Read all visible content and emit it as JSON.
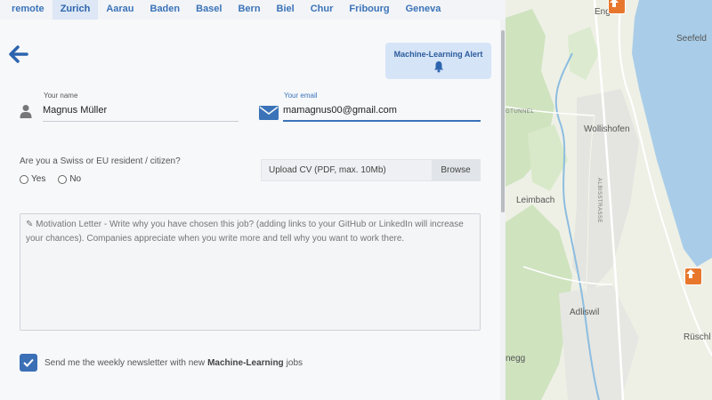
{
  "tabs": [
    {
      "label": "remote",
      "active": false
    },
    {
      "label": "Zurich",
      "active": true
    },
    {
      "label": "Aarau",
      "active": false
    },
    {
      "label": "Baden",
      "active": false
    },
    {
      "label": "Basel",
      "active": false
    },
    {
      "label": "Bern",
      "active": false
    },
    {
      "label": "Biel",
      "active": false
    },
    {
      "label": "Chur",
      "active": false
    },
    {
      "label": "Fribourg",
      "active": false
    },
    {
      "label": "Geneva",
      "active": false
    }
  ],
  "alert": {
    "label": "Machine-Learning Alert",
    "icon": "bell-icon"
  },
  "form": {
    "name_label": "Your name",
    "name_value": "Magnus Müller",
    "email_label": "Your email",
    "email_value": "mamagnus00@gmail.com",
    "residency_question": "Are you a Swiss or EU resident / citizen?",
    "residency_options": [
      "Yes",
      "No"
    ],
    "upload_placeholder": "Upload CV (PDF, max. 10Mb)",
    "browse_label": "Browse",
    "letter_placeholder": "✎ Motivation Letter - Write why you have chosen this job? (adding links to your GitHub or LinkedIn will increase your chances). Companies appreciate when you write more and tell why you want to work there.",
    "newsletter_prefix": "Send me the weekly newsletter with new",
    "newsletter_bold": "Machine-Learning",
    "newsletter_suffix": "jobs",
    "newsletter_checked": true
  },
  "map": {
    "labels": [
      "Enge",
      "Seefeld",
      "Wollishofen",
      "Leimbach",
      "Adliswil",
      "Rüschl",
      "negg",
      "GTUNNEL",
      "ALBISSTRASSE"
    ],
    "colors": {
      "lake": "#a9cde8",
      "forest": "#cfe3bf",
      "land": "#eef0e6",
      "pin": "#e8772e",
      "road": "#ffffff"
    }
  },
  "colors": {
    "accent": "#3b73b9",
    "alert_bg": "#d6e4f7"
  }
}
